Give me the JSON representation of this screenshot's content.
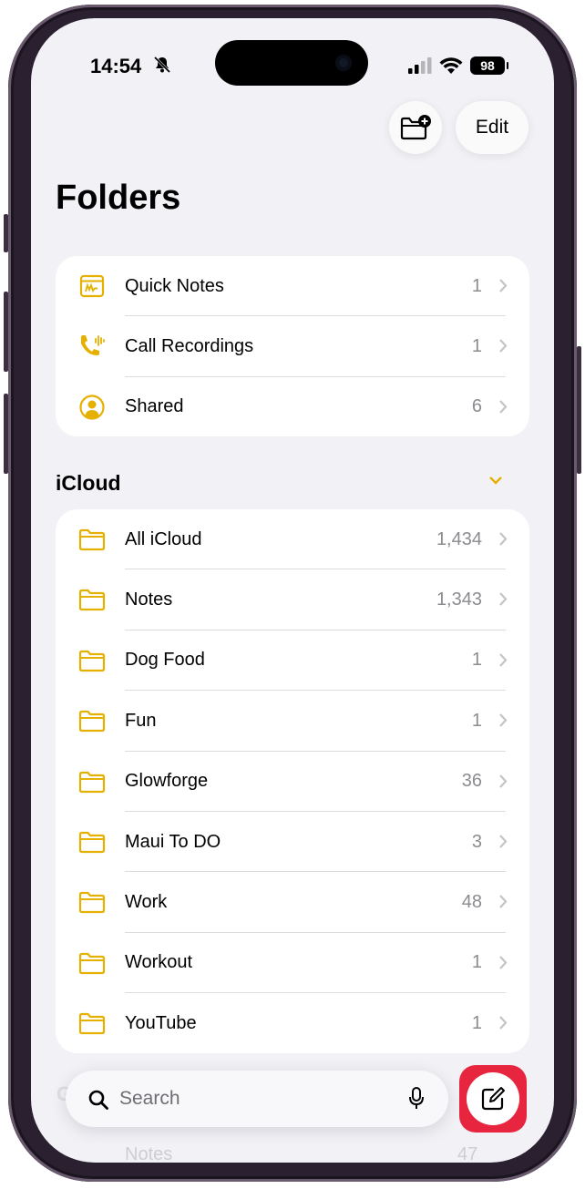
{
  "status_bar": {
    "time": "14:54",
    "battery": "98"
  },
  "header": {
    "edit_label": "Edit"
  },
  "page_title": "Folders",
  "pinned_folders": [
    {
      "icon": "quick-notes-icon",
      "label": "Quick Notes",
      "count": "1"
    },
    {
      "icon": "call-recording-icon",
      "label": "Call Recordings",
      "count": "1"
    },
    {
      "icon": "shared-person-icon",
      "label": "Shared",
      "count": "6"
    }
  ],
  "icloud": {
    "title": "iCloud",
    "folders": [
      {
        "label": "All iCloud",
        "count": "1,434"
      },
      {
        "label": "Notes",
        "count": "1,343"
      },
      {
        "label": "Dog Food",
        "count": "1"
      },
      {
        "label": "Fun",
        "count": "1"
      },
      {
        "label": "Glowforge",
        "count": "36"
      },
      {
        "label": "Maui To DO",
        "count": "3"
      },
      {
        "label": "Work",
        "count": "48"
      },
      {
        "label": "Workout",
        "count": "1"
      },
      {
        "label": "YouTube",
        "count": "1"
      }
    ]
  },
  "next_section": {
    "title_partial": "G",
    "row_label": "Notes",
    "row_count": "47"
  },
  "search": {
    "placeholder": "Search"
  },
  "colors": {
    "accent": "#E5B000",
    "highlight": "#E8253F",
    "background": "#F2F1F6"
  }
}
